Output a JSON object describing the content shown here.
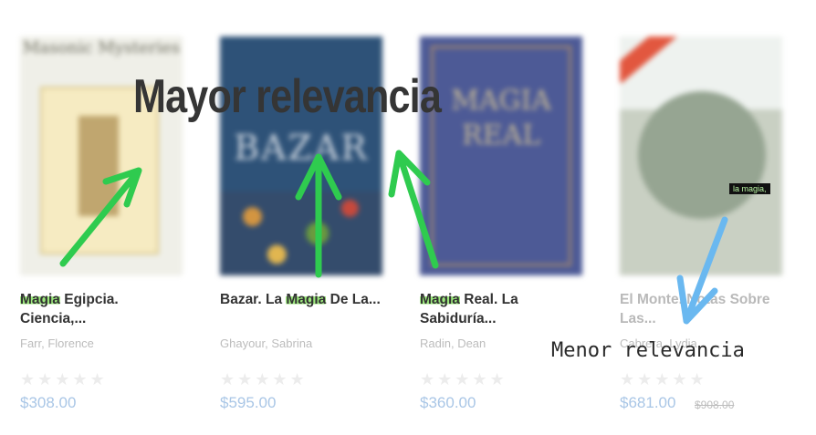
{
  "labels": {
    "top": "Mayor relevancia",
    "bottom": "Menor relevancia",
    "tag": "la magia,"
  },
  "colors": {
    "arrow_green": "#2fcb4f",
    "arrow_blue": "#6ab8f0",
    "highlight": "#9ce87d",
    "price": "#a9c6e6"
  },
  "products": [
    {
      "cover_text": "Masonic Mysteries",
      "title_hl": "Magia",
      "title_rest": " Egipcia. Ciencia,...",
      "author": "Farr, Florence",
      "stars": "★★★★★",
      "price": "$308.00",
      "rating": 0
    },
    {
      "cover_text": "BAZAR",
      "title_pre": "Bazar. La ",
      "title_hl": "Magia",
      "title_rest": " De La...",
      "author": "Ghayour, Sabrina",
      "stars": "★★★★★",
      "price": "$595.00",
      "rating": 0
    },
    {
      "cover_text": "MAGIA REAL",
      "title_hl": "Magia",
      "title_rest": " Real. La Sabiduría...",
      "author": "Radin, Dean",
      "stars": "★★★★★",
      "price": "$360.00",
      "rating": 0
    },
    {
      "cover_text": "",
      "title": "El Monte. Notas Sobre Las...",
      "author": "Cabrera, Lydia",
      "stars": "★★★★★",
      "price": "$681.00",
      "old_price": "$908.00",
      "rating": 0
    }
  ]
}
